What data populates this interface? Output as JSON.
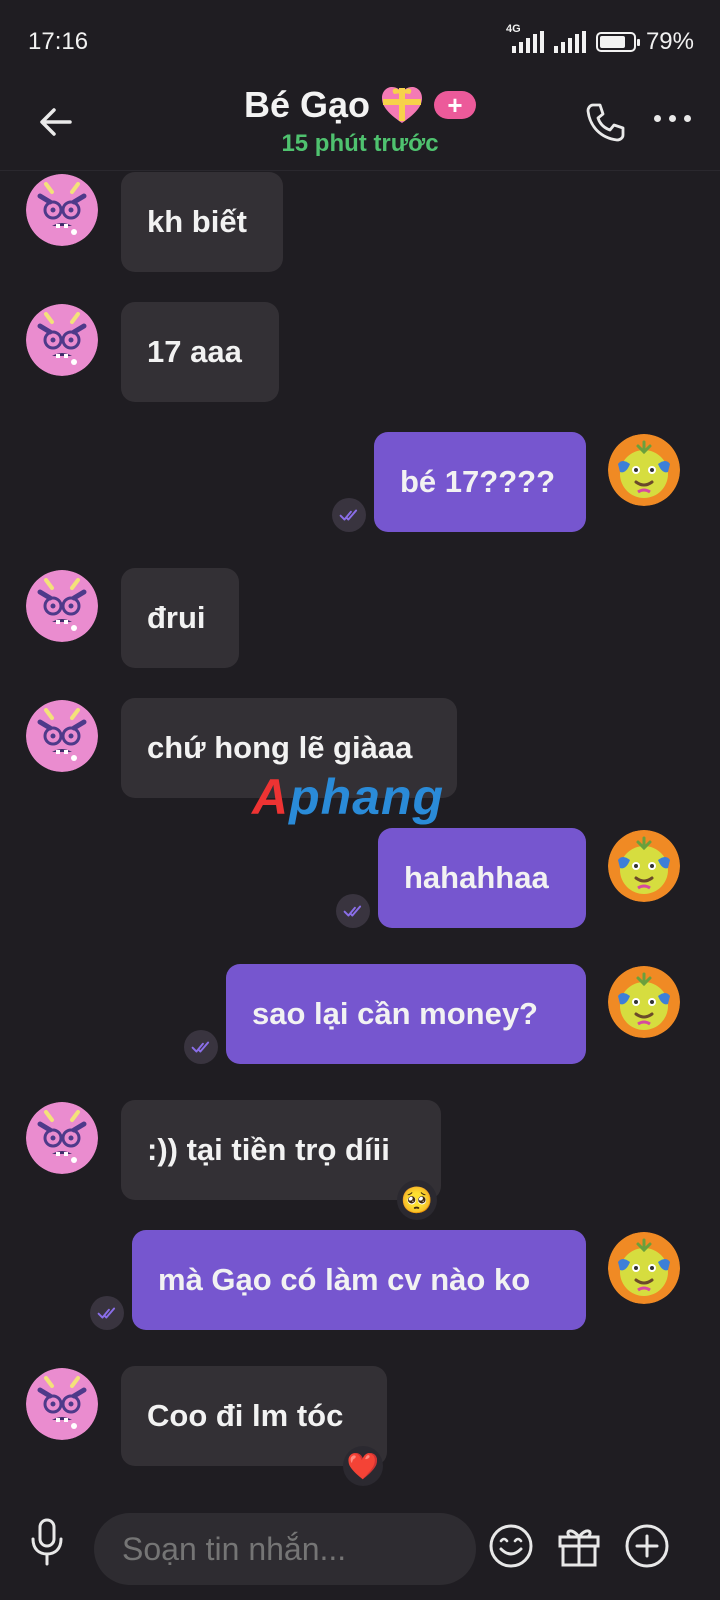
{
  "status_bar": {
    "time": "17:16",
    "network": "4G",
    "battery_percent_text": "79%",
    "battery_level": 0.79
  },
  "header": {
    "title": "Bé Gạo",
    "subtitle": "15 phút trước",
    "badge_symbol": "+"
  },
  "messages": [
    {
      "side": "in",
      "text": "kh biết"
    },
    {
      "side": "in",
      "text": "17 aaa"
    },
    {
      "side": "out",
      "text": "bé 17????",
      "seen": true
    },
    {
      "side": "in",
      "text": "đrui"
    },
    {
      "side": "in",
      "text": "chứ hong lẽ giàaa"
    },
    {
      "side": "out",
      "text": "hahahhaa",
      "seen": true
    },
    {
      "side": "out",
      "text": "sao lại cần money?",
      "seen": true
    },
    {
      "side": "in",
      "text": ":)) tại tiền trọ díii",
      "reaction": "🥺"
    },
    {
      "side": "out",
      "text": "mà Gạo có làm cv nào ko",
      "seen": true
    },
    {
      "side": "in",
      "text": "Coo đi lm tóc",
      "reaction": "❤️"
    }
  ],
  "watermark": {
    "part1": "A",
    "part2": "phang"
  },
  "composer": {
    "placeholder": "Soạn tin nhắn..."
  },
  "colors": {
    "background": "#1f1d22",
    "incoming_bubble": "#333035",
    "outgoing_bubble": "#7656cf",
    "subtitle_green": "#4fc26f",
    "badge_pink": "#ec5a9a"
  },
  "icons": [
    "back-arrow-icon",
    "heart-gift-icon",
    "phone-icon",
    "more-icon",
    "seen-check-icon",
    "microphone-icon",
    "emoji-icon",
    "gift-icon",
    "add-icon"
  ]
}
